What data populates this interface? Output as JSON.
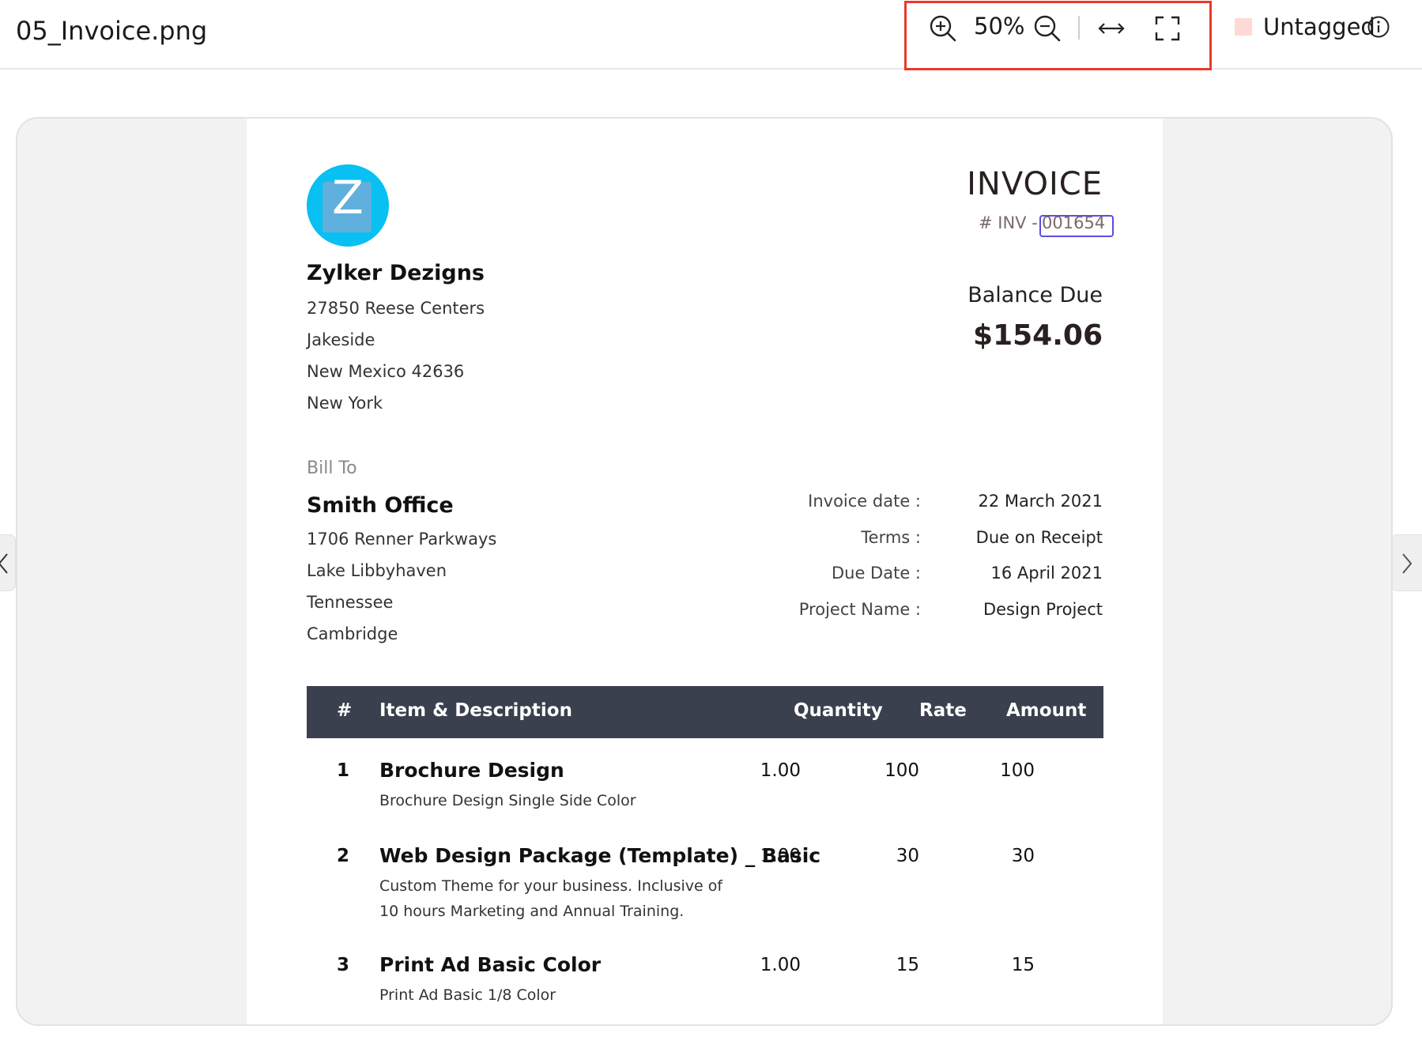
{
  "header": {
    "filename": "05_Invoice.png",
    "zoom_level": "50%",
    "tag_label": "Untagged",
    "icons": [
      "zoom-in-icon",
      "zoom-out-icon",
      "fit-width-icon",
      "fullscreen-icon",
      "info-icon"
    ]
  },
  "colors": {
    "highlight": "#e8392b",
    "selection": "#5a4de0",
    "tag_swatch": "#ffd9d3",
    "table_header": "#3b404e",
    "logo": "#08c0f1"
  },
  "invoice": {
    "logo_letter": "Z",
    "title": "INVOICE",
    "number_prefix": "# INV -",
    "number": "001654",
    "balance_label": "Balance Due",
    "balance_amount": "$154.06",
    "company": {
      "name": "Zylker Dezigns",
      "address": [
        "27850 Reese Centers",
        "Jakeside",
        "New Mexico 42636",
        "New York"
      ]
    },
    "bill_to": {
      "label": "Bill To",
      "name": "Smith Office",
      "address": [
        "1706 Renner Parkways",
        "Lake Libbyhaven",
        "Tennessee",
        "Cambridge"
      ]
    },
    "meta": [
      {
        "label": "Invoice date :",
        "value": "22 March 2021"
      },
      {
        "label": "Terms :",
        "value": "Due on Receipt"
      },
      {
        "label": "Due Date :",
        "value": "16 April 2021"
      },
      {
        "label": "Project Name :",
        "value": "Design Project"
      }
    ],
    "table": {
      "columns": {
        "num": "#",
        "item": "Item  & Description",
        "quantity": "Quantity",
        "rate": "Rate",
        "amount": "Amount"
      },
      "rows": [
        {
          "num": "1",
          "name": "Brochure Design",
          "desc": [
            "Brochure Design Single Side Color"
          ],
          "quantity": "1.00",
          "rate": "100",
          "amount": "100"
        },
        {
          "num": "2",
          "name": "Web Design Package (Template) _ Basic",
          "desc": [
            "Custom Theme for your business. Inclusive of",
            "10 hours Marketing and Annual Training."
          ],
          "quantity": "1.00",
          "rate": "30",
          "amount": "30"
        },
        {
          "num": "3",
          "name": "Print Ad Basic Color",
          "desc": [
            "Print Ad Basic 1/8 Color"
          ],
          "quantity": "1.00",
          "rate": "15",
          "amount": "15"
        }
      ]
    }
  }
}
